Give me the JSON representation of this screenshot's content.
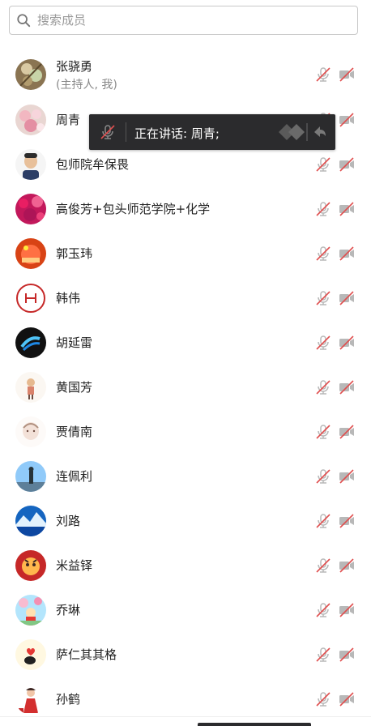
{
  "search": {
    "placeholder": "搜索成员",
    "value": ""
  },
  "members": [
    {
      "name": "张骁勇",
      "sub": "(主持人, 我)",
      "avatar": "flowers-branch",
      "mic": "muted",
      "camera": "off"
    },
    {
      "name": "周青",
      "sub": "",
      "avatar": "pink-flowers",
      "mic": "muted",
      "camera": "off"
    },
    {
      "name": "包师院牟保畏",
      "sub": "",
      "avatar": "child-portrait",
      "mic": "muted",
      "camera": "off"
    },
    {
      "name": "高俊芳+包头师范学院+化学",
      "sub": "",
      "avatar": "magenta-flowers",
      "mic": "muted",
      "camera": "off"
    },
    {
      "name": "郭玉玮",
      "sub": "",
      "avatar": "red-lanterns",
      "mic": "muted",
      "camera": "off"
    },
    {
      "name": "韩伟",
      "sub": "",
      "avatar": "white-logo",
      "mic": "muted",
      "camera": "off"
    },
    {
      "name": "胡延雷",
      "sub": "",
      "avatar": "blue-light-dark",
      "mic": "muted",
      "camera": "off"
    },
    {
      "name": "黄国芳",
      "sub": "",
      "avatar": "cartoon-figure",
      "mic": "muted",
      "camera": "off"
    },
    {
      "name": "贾倩南",
      "sub": "",
      "avatar": "baby-sketch",
      "mic": "muted",
      "camera": "off"
    },
    {
      "name": "连佩利",
      "sub": "",
      "avatar": "person-sky",
      "mic": "muted",
      "camera": "off"
    },
    {
      "name": "刘路",
      "sub": "",
      "avatar": "mountain-lake",
      "mic": "muted",
      "camera": "off"
    },
    {
      "name": "米益铎",
      "sub": "",
      "avatar": "tiger-cartoon",
      "mic": "muted",
      "camera": "off"
    },
    {
      "name": "乔琳",
      "sub": "",
      "avatar": "girl-blossoms",
      "mic": "muted",
      "camera": "off"
    },
    {
      "name": "萨仁其其格",
      "sub": "",
      "avatar": "heart-cartoon",
      "mic": "muted",
      "camera": "off"
    },
    {
      "name": "孙鹤",
      "sub": "",
      "avatar": "girl-red-dress",
      "mic": "muted",
      "camera": "off"
    }
  ],
  "speaking": {
    "text": "正在讲话: 周青;"
  },
  "colors": {
    "mute_red": "#e04f4f",
    "icon_gray": "#b8b8b8",
    "overlay_bg": "#2b2b2d"
  }
}
